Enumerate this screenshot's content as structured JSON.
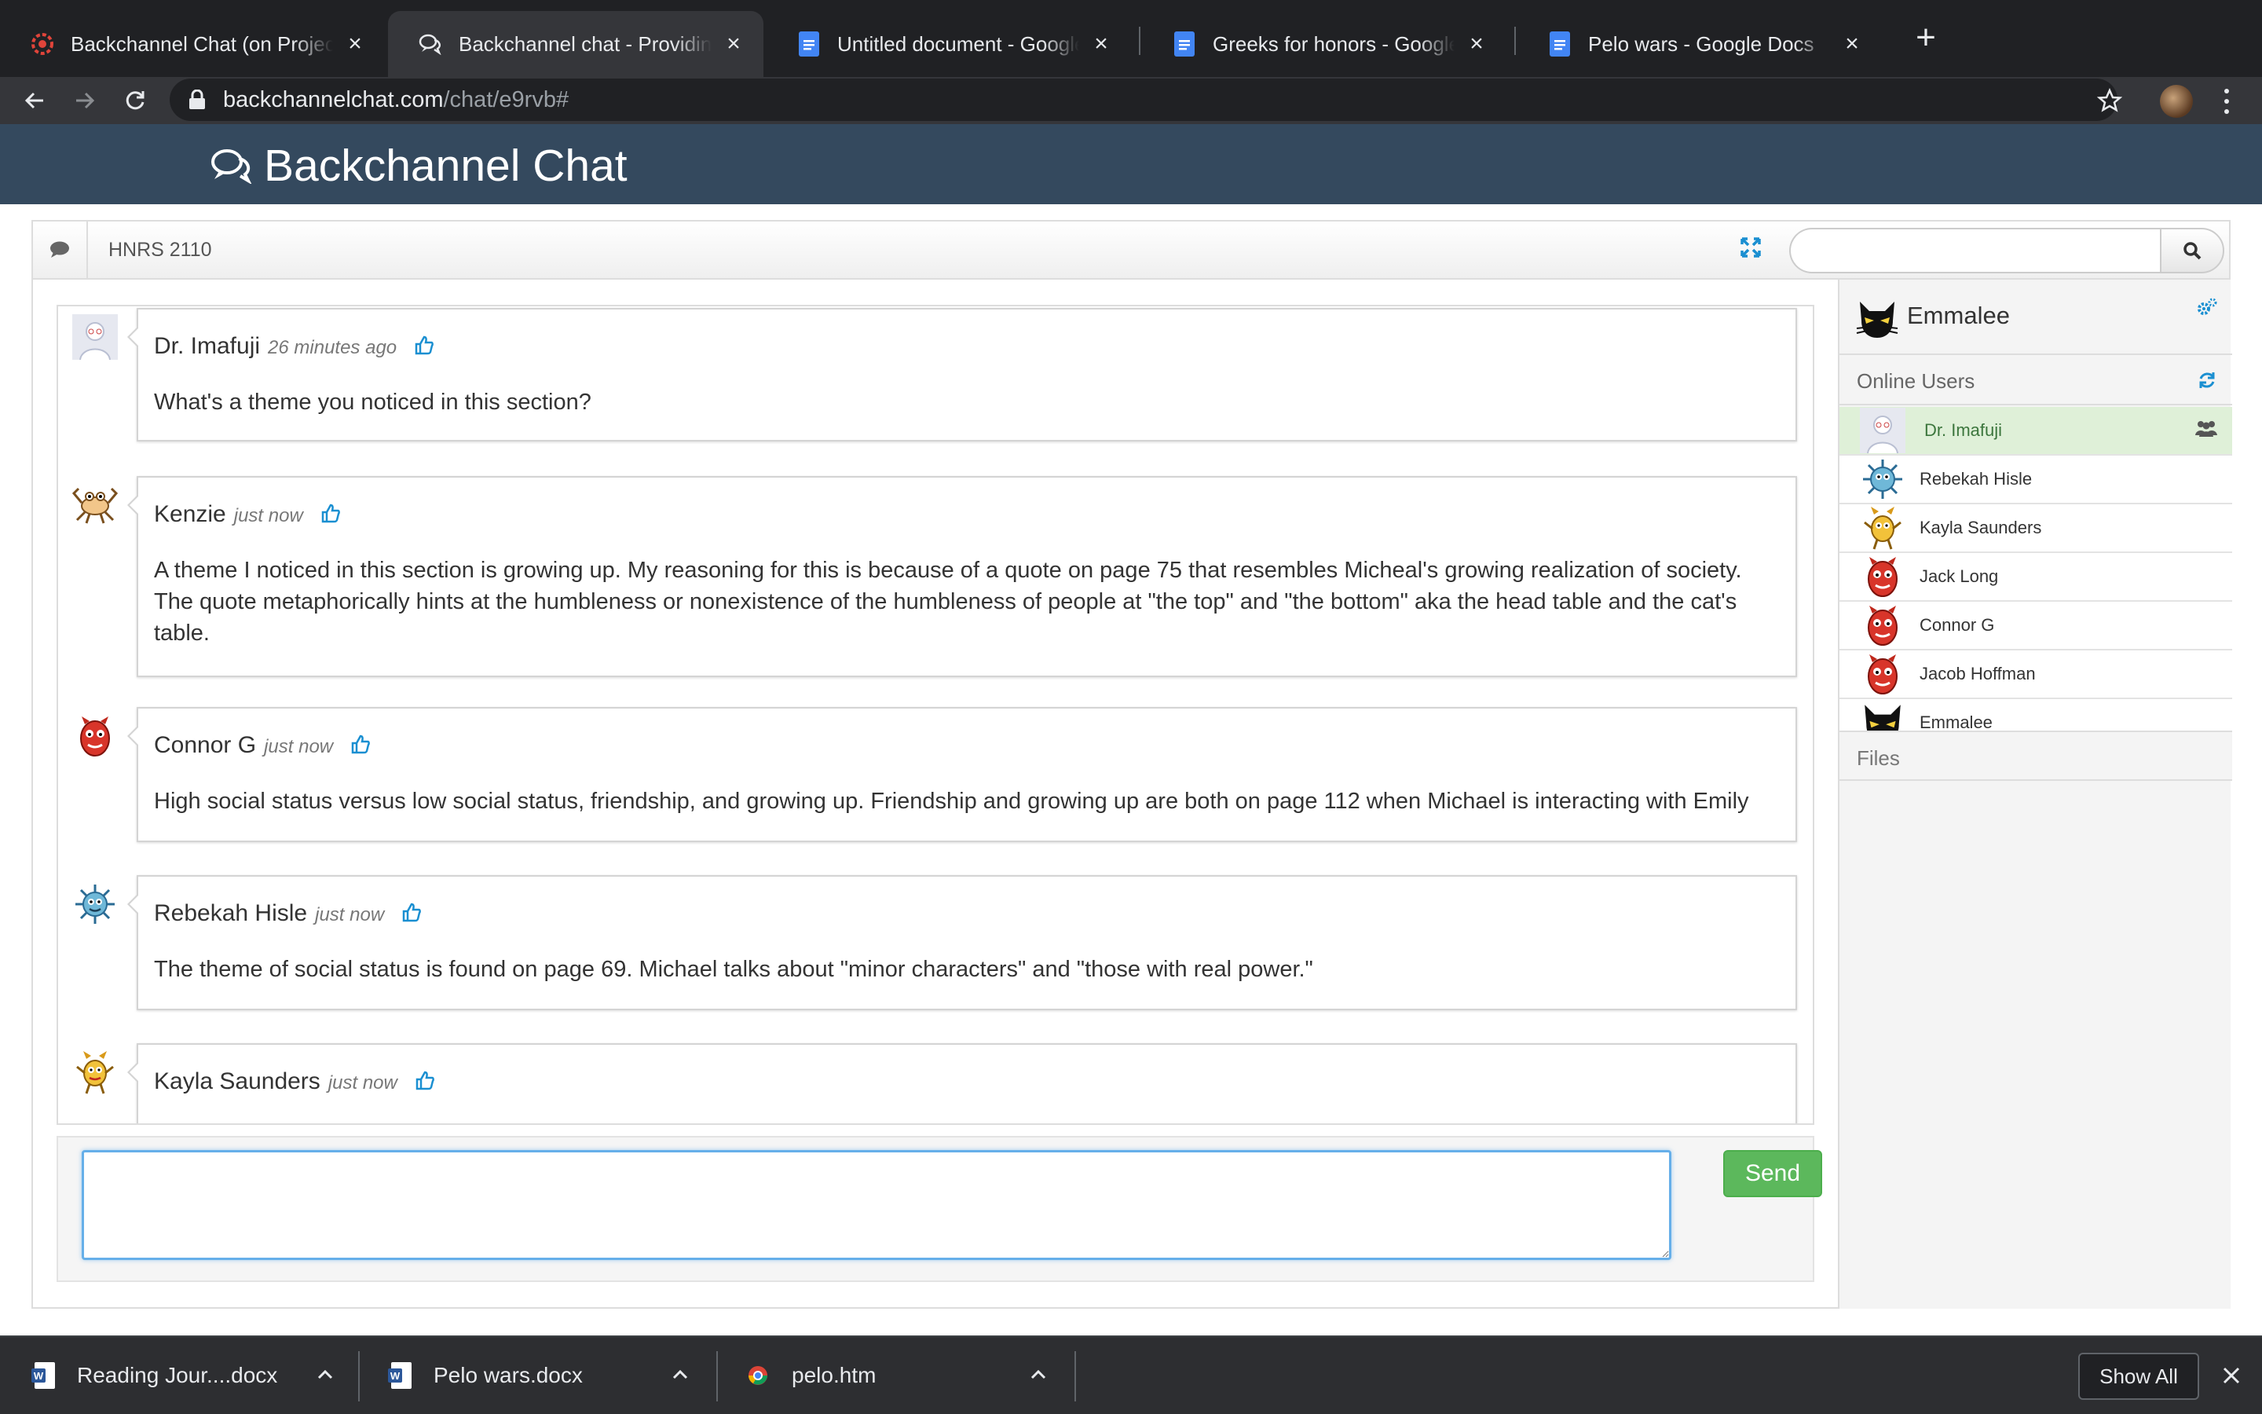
{
  "browser": {
    "tabs": [
      {
        "title": "Backchannel Chat (on Projector)",
        "icon": "red-gear-favicon",
        "active": false
      },
      {
        "title": "Backchannel chat - Providing classroom",
        "icon": "chat-bubbles-favicon",
        "active": true
      },
      {
        "title": "Untitled document - Google Docs",
        "icon": "google-docs-favicon",
        "active": false
      },
      {
        "title": "Greeks for honors - Google Docs",
        "icon": "google-docs-favicon",
        "active": false
      },
      {
        "title": "Pelo wars - Google Docs",
        "icon": "google-docs-favicon",
        "active": false
      }
    ],
    "url_host": "backchannelchat.com",
    "url_path": "/chat/e9rvb#"
  },
  "app": {
    "brand": "Backchannel Chat",
    "room_name": "HNRS 2110",
    "search_placeholder": "",
    "composer_placeholder": "",
    "send_label": "Send"
  },
  "messages": [
    {
      "author": "Dr. Imafuji",
      "time": "26 minutes ago",
      "avatar": "teacher-avatar",
      "text": "What's a theme you noticed in this section?"
    },
    {
      "author": "Kenzie",
      "time": "just now",
      "avatar": "crab-monster-avatar",
      "text": "A theme I noticed in this section is growing up. My reasoning for this is because of a quote on page 75 that resembles Micheal's growing realization of society. The quote metaphorically hints at the humbleness or nonexistence of the humbleness of people at \"the top\" and \"the bottom\" aka the head table and the cat's table."
    },
    {
      "author": "Connor G",
      "time": "just now",
      "avatar": "red-monster-avatar",
      "text": "High social status versus low social status, friendship, and growing up. Friendship and growing up are both on page 112 when Michael is interacting with Emily"
    },
    {
      "author": "Rebekah Hisle",
      "time": "just now",
      "avatar": "blue-virus-avatar",
      "text": "The theme of social status is found on page 69. Michael talks about \"minor characters\" and \"those with real power.\""
    },
    {
      "author": "Kayla Saunders",
      "time": "just now",
      "avatar": "yellow-monster-avatar",
      "text": ""
    }
  ],
  "sidebar": {
    "me": {
      "name": "Emmalee",
      "avatar": "black-cat-avatar"
    },
    "online_title": "Online Users",
    "users": [
      {
        "name": "Dr. Imafuji",
        "avatar": "teacher-avatar",
        "highlight": true
      },
      {
        "name": "Rebekah Hisle",
        "avatar": "blue-virus-avatar"
      },
      {
        "name": "Kayla Saunders",
        "avatar": "yellow-monster-avatar"
      },
      {
        "name": "Jack Long",
        "avatar": "red-monster-avatar"
      },
      {
        "name": "Connor G",
        "avatar": "red-monster-avatar"
      },
      {
        "name": "Jacob Hoffman",
        "avatar": "red-monster-avatar"
      },
      {
        "name": "Emmalee",
        "avatar": "black-cat-avatar"
      }
    ],
    "files_title": "Files"
  },
  "downloads": {
    "items": [
      {
        "name": "Reading Jour....docx",
        "icon": "word-doc-icon"
      },
      {
        "name": "Pelo wars.docx",
        "icon": "word-doc-icon"
      },
      {
        "name": "pelo.htm",
        "icon": "chrome-html-icon"
      }
    ],
    "show_all_label": "Show All"
  },
  "colors": {
    "header_bg": "#34495e",
    "send_green": "#5cb85c",
    "like_blue": "#1a8fd1",
    "highlight_green": "#dff0d8"
  }
}
